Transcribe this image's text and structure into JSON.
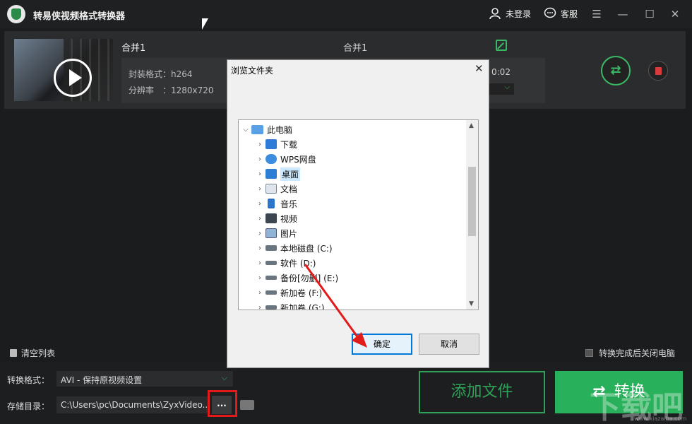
{
  "app": {
    "title": "转易侠视频格式转换器"
  },
  "header": {
    "user_label": "未登录",
    "service_label": "客服"
  },
  "file": {
    "name": "合并1",
    "output_name": "合并1",
    "format_label": "封装格式：h264",
    "resolution_label": "分辨率　：1280x720",
    "duration_partial": "0:02"
  },
  "toolbar": {
    "clear_list": "清空列表",
    "shutdown_after": "转换完成后关闭电脑",
    "format_label": "转换格式：",
    "format_value": "AVI - 保持原视频设置",
    "dir_label": "存储目录：",
    "dir_value": "C:\\Users\\pc\\Documents\\ZyxVideo...",
    "browse_label": "...",
    "add_file": "添加文件",
    "convert": "转换"
  },
  "dialog": {
    "title": "浏览文件夹",
    "tree": [
      {
        "label": "此电脑",
        "icon": "computer-icon",
        "expanded": true,
        "selected": false
      },
      {
        "label": "下载",
        "icon": "download-icon",
        "selected": false
      },
      {
        "label": "WPS网盘",
        "icon": "cloud-icon",
        "selected": false
      },
      {
        "label": "桌面",
        "icon": "desktop-icon",
        "selected": true
      },
      {
        "label": "文档",
        "icon": "document-icon",
        "selected": false
      },
      {
        "label": "音乐",
        "icon": "music-icon",
        "selected": false
      },
      {
        "label": "视频",
        "icon": "video-icon",
        "selected": false
      },
      {
        "label": "图片",
        "icon": "picture-icon",
        "selected": false
      },
      {
        "label": "本地磁盘 (C:)",
        "icon": "drive-icon",
        "selected": false
      },
      {
        "label": "软件 (D:)",
        "icon": "drive-icon",
        "selected": false
      },
      {
        "label": "备份[勿删] (E:)",
        "icon": "drive-icon",
        "selected": false
      },
      {
        "label": "新加卷 (F:)",
        "icon": "drive-icon",
        "selected": false
      },
      {
        "label": "新加卷 (G:)",
        "icon": "drive-icon",
        "selected": false
      }
    ],
    "ok": "确定",
    "cancel": "取消"
  },
  "watermark": {
    "text": "下载吧",
    "sub": "www.xiazaiba.com"
  },
  "colors": {
    "accent": "#2fa158",
    "highlight": "#e21a1a",
    "dialog_selection": "#cce8ff"
  }
}
